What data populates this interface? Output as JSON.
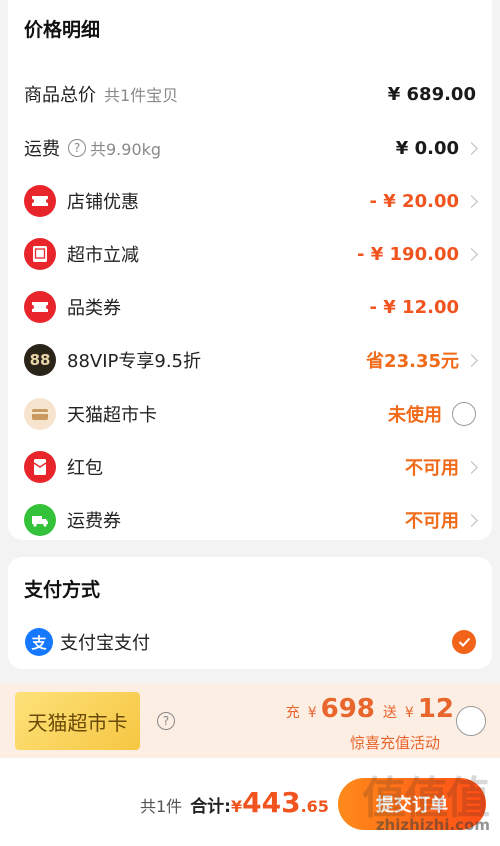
{
  "price_section": {
    "title": "价格明细",
    "rows": [
      {
        "label": "商品总价",
        "sub": "共1件宝贝",
        "value": "¥ 689.00"
      },
      {
        "label": "运费",
        "sub": "共9.90kg",
        "value": "¥ 0.00"
      },
      {
        "label": "店铺优惠",
        "value": "- ¥ 20.00",
        "icon": "ticket-icon"
      },
      {
        "label": "超市立减",
        "value": "- ¥ 190.00",
        "icon": "discount-icon"
      },
      {
        "label": "品类券",
        "value": "- ¥ 12.00",
        "icon": "coupon-icon"
      },
      {
        "label": "88VIP专享9.5折",
        "value": "省23.35元",
        "icon": "vip88-icon",
        "icon_text": "88"
      },
      {
        "label": "天猫超市卡",
        "value": "未使用",
        "icon": "card-icon"
      },
      {
        "label": "红包",
        "value": "不可用",
        "icon": "red-packet-icon"
      },
      {
        "label": "运费券",
        "value": "不可用",
        "icon": "truck-icon"
      }
    ]
  },
  "payment_section": {
    "title": "支付方式",
    "method": "支付宝支付",
    "method_icon_text": "支"
  },
  "promo": {
    "card_label": "天猫超市卡",
    "charge_prefix": "充",
    "charge_currency": "¥",
    "charge_amount": "698",
    "gift_prefix": "送",
    "gift_currency": "¥",
    "gift_amount": "12",
    "hint": "惊喜充值活动"
  },
  "footer": {
    "count": "共1件",
    "total_label": "合计:",
    "currency": "¥",
    "amount_int": "443",
    "amount_dec": ".65",
    "submit_label": "提交订单",
    "watermark": "zhizhizhi.com",
    "watermark_glyph": "值值值"
  },
  "colors": {
    "accent": "#f2541f",
    "card_red": "#e8252b",
    "alipay_blue": "#1677ff",
    "green": "#34c23a"
  }
}
